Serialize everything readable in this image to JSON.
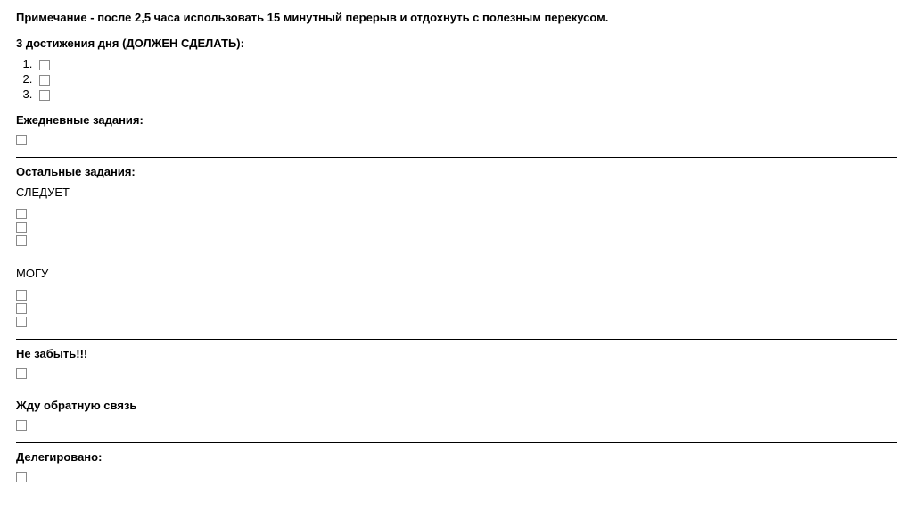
{
  "note": "Примечание - после 2,5 часа использовать 15 минутный перерыв и отдохнуть с полезным перекусом.",
  "achievements_heading": "3 достижения дня (ДОЛЖЕН СДЕЛАТЬ):",
  "daily_heading": "Ежедневные задания:",
  "remaining_heading": "Остальные задания:",
  "should_label": "СЛЕДУЕТ",
  "can_label": "МОГУ",
  "dont_forget_heading": "Не забыть!!!",
  "feedback_heading": "Жду обратную связь",
  "delegated_heading": "Делегировано:"
}
